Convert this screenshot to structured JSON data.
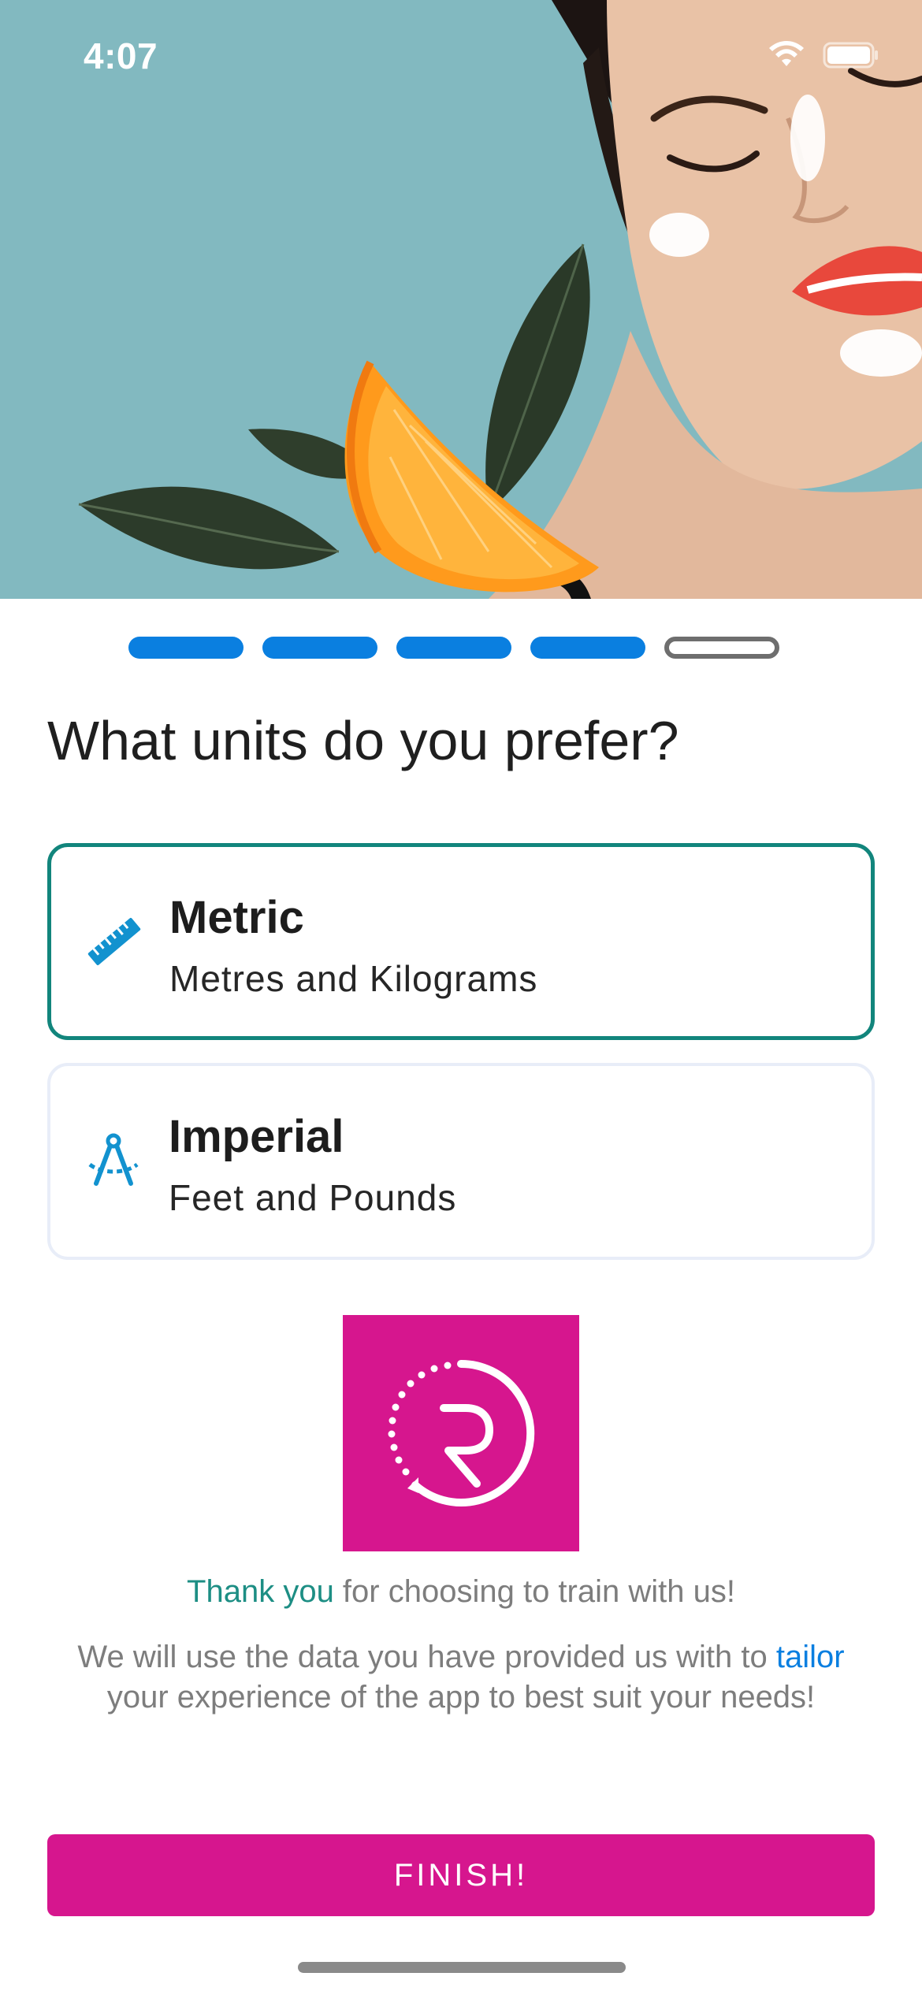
{
  "status_bar": {
    "time": "4:07"
  },
  "hero": {
    "image_alt": "Woman with face cream, orange slice and leaves"
  },
  "progress": {
    "total_steps": 5,
    "completed_steps": 4
  },
  "question": "What units do you prefer?",
  "options": [
    {
      "id": "metric",
      "title": "Metric",
      "subtitle": "Metres and Kilograms",
      "icon": "ruler-icon",
      "selected": true
    },
    {
      "id": "imperial",
      "title": "Imperial",
      "subtitle": "Feet and Pounds",
      "icon": "compass-icon",
      "selected": false
    }
  ],
  "thanks": {
    "accent": "Thank you",
    "rest": " for choosing to train with us!"
  },
  "info": {
    "before": "We will use the data you have provided us with to ",
    "accent": "tailor",
    "after": " your experience of the app to best suit your needs!"
  },
  "finish_button": "FINISH!",
  "colors": {
    "brand_pink": "#d6168e",
    "accent_teal": "#12857c",
    "accent_blue": "#0a7fe0",
    "hero_bg": "#82b9c0"
  }
}
